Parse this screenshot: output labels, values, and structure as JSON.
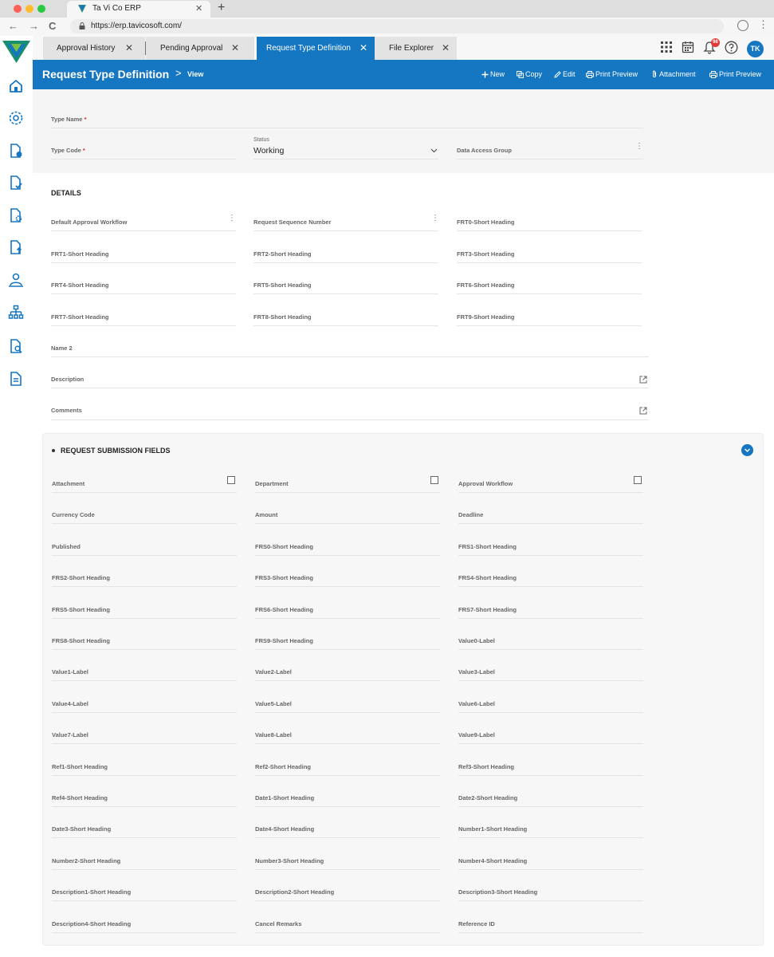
{
  "browser": {
    "tab_title": "Ta Vi Co ERP",
    "tab_close": "✕",
    "new_tab": "+",
    "back": "←",
    "forward": "→",
    "reload": "C",
    "url": "https://erp.tavicosoft.com/",
    "menu": "⋮"
  },
  "app_tabs": [
    {
      "label": "Approval History",
      "close": "✕"
    },
    {
      "label": "Pending Approval",
      "close": "✕"
    },
    {
      "label": "Request Type Definition",
      "close": "✕"
    },
    {
      "label": "File Explorer",
      "close": "✕"
    }
  ],
  "header": {
    "notification_count": "98",
    "avatar_initials": "TK"
  },
  "page": {
    "title": "Request Type Definition",
    "breadcrumb_sep": ">",
    "mode": "View",
    "actions": {
      "new": "New",
      "copy": "Copy",
      "edit": "Edit",
      "print_preview": "Print Preview",
      "attachment": "Attachment",
      "print_preview_2": "Print Preview"
    }
  },
  "top_form": {
    "type_name_label": "Type Name",
    "type_code_label": "Type Code",
    "required_mark": "*",
    "status_caption": "Status",
    "status_value": "Working",
    "data_access_group_label": "Data Access Group",
    "kebab": "⋮"
  },
  "details": {
    "title": "DETAILS",
    "fields": [
      "Default Approval Workflow",
      "Request Sequence Number",
      "FRT0-Short Heading",
      "FRT1-Short Heading",
      "FRT2-Short Heading",
      "FRT3-Short Heading",
      "FRT4-Short Heading",
      "FRT5-Short Heading",
      "FRT6-Short Heading",
      "FRT7-Short Heading",
      "FRT8-Short Heading",
      "FRT9-Short Heading"
    ],
    "name2_label": "Name 2",
    "description_label": "Description",
    "comments_label": "Comments"
  },
  "rsf": {
    "title": "REQUEST SUBMISSION FIELDS",
    "fields": [
      "Attachment",
      "Department",
      "Approval Workflow",
      "Currency Code",
      "Amount",
      "Deadline",
      "Published",
      "FRS0-Short Heading",
      "FRS1-Short Heading",
      "FRS2-Short Heading",
      "FRS3-Short Heading",
      "FRS4-Short Heading",
      "FRS5-Short Heading",
      "FRS6-Short Heading",
      "FRS7-Short Heading",
      "FRS8-Short Heading",
      "FRS9-Short Heading",
      "Value0-Label",
      "Value1-Label",
      "Value2-Label",
      "Value3-Label",
      "Value4-Label",
      "Value5-Label",
      "Value6-Label",
      "Value7-Label",
      "Value8-Label",
      "Value9-Label",
      "Ref1-Short Heading",
      "Ref2-Short Heading",
      "Ref3-Short Heading",
      "Ref4-Short Heading",
      "Date1-Short Heading",
      "Date2-Short Heading",
      "Date3-Short Heading",
      "Date4-Short Heading",
      "Number1-Short Heading",
      "Number2-Short Heading",
      "Number3-Short Heading",
      "Number4-Short Heading",
      "Description1-Short Heading",
      "Description2-Short Heading",
      "Description3-Short Heading",
      "Description4-Short Heading",
      "Cancel Remarks",
      "Reference ID"
    ]
  },
  "sidebar_icons": [
    "home-icon",
    "settings-icon",
    "document-clock-icon",
    "document-check-icon",
    "document-gear-icon",
    "document-upload-icon",
    "user-group-icon",
    "org-chart-icon",
    "document-search-icon",
    "document-lines-icon"
  ],
  "colors": {
    "brand_blue": "#1576c2",
    "required_red": "#d32f2f",
    "badge_red": "#e53935"
  }
}
